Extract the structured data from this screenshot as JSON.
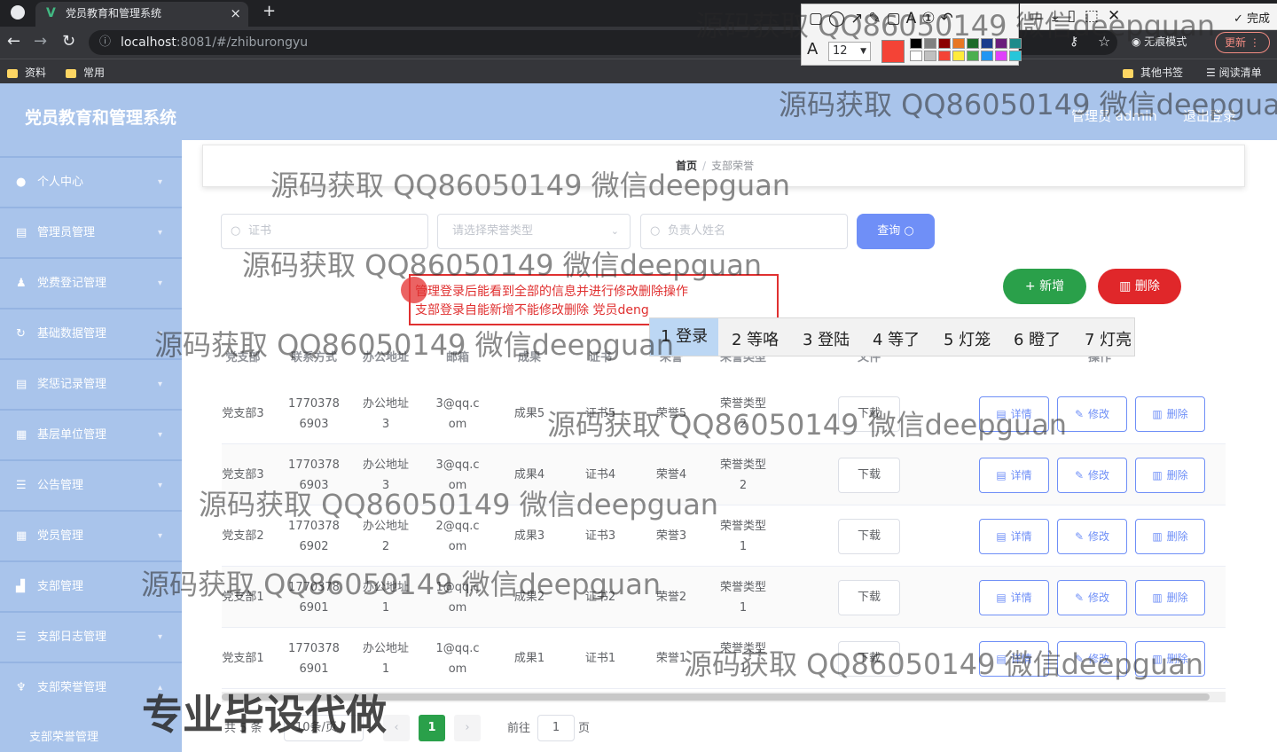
{
  "browser": {
    "tab_title": "党员教育和管理系统",
    "tab_favicon": "V",
    "url_host": "localhost",
    "url_rest": ":8081/#/zhiburongyu",
    "incognito_label": "无痕模式",
    "update_label": "更新",
    "bookmarks": [
      "资料",
      "常用"
    ],
    "bookmarks_right": [
      "其他书签",
      "阅读清单"
    ]
  },
  "annotation_tool": {
    "font_size": "12",
    "current_color": "#f44336",
    "done_label": "完成"
  },
  "app": {
    "title": "党员教育和管理系统",
    "admin_label": "管理员 admin",
    "logout_label": "退出登录"
  },
  "sidebar": {
    "items": [
      {
        "label": "个人中心",
        "icon": "user-icon"
      },
      {
        "label": "管理员管理",
        "icon": "list-icon"
      },
      {
        "label": "党费登记管理",
        "icon": "person-icon"
      },
      {
        "label": "基础数据管理",
        "icon": "refresh-icon"
      },
      {
        "label": "奖惩记录管理",
        "icon": "list-icon"
      },
      {
        "label": "基层单位管理",
        "icon": "grid-icon"
      },
      {
        "label": "公告管理",
        "icon": "menu-icon"
      },
      {
        "label": "党员管理",
        "icon": "grid-icon"
      },
      {
        "label": "支部管理",
        "icon": "chart-icon"
      },
      {
        "label": "支部日志管理",
        "icon": "menu-icon"
      },
      {
        "label": "支部荣誉管理",
        "icon": "trophy-icon"
      }
    ],
    "sub_item": "支部荣誉管理"
  },
  "breadcrumb": {
    "home": "首页",
    "separator": "/",
    "current": "支部荣誉"
  },
  "search": {
    "certificate_placeholder": "证书",
    "honor_type_placeholder": "请选择荣誉类型",
    "leader_placeholder": "负责人姓名",
    "query_label": "查询"
  },
  "actions": {
    "add_label": "新增",
    "delete_label": "删除"
  },
  "note": {
    "line1": "管理登录后能看到全部的信息并进行修改删除操作",
    "line2": "支部登录自能新增不能修改删除 党员deng"
  },
  "ime": {
    "candidates": [
      "1 登录",
      "2 等咯",
      "3 登陆",
      "4 等了",
      "5 灯笼",
      "6 瞪了",
      "7 灯亮"
    ]
  },
  "table": {
    "headers": [
      "党支部",
      "联系方式",
      "办公地址",
      "邮箱",
      "成果",
      "证书",
      "荣誉",
      "荣誉类型",
      "文件",
      "操作"
    ],
    "rows": [
      {
        "branch": "党支部3",
        "phone1": "1770378",
        "phone2": "6903",
        "addr1": "办公地址",
        "addr2": "3",
        "email1": "3@qq.c",
        "email2": "om",
        "result": "成果5",
        "cert": "证书5",
        "honor": "荣誉5",
        "type1": "荣誉类型",
        "type2": "2"
      },
      {
        "branch": "党支部3",
        "phone1": "1770378",
        "phone2": "6903",
        "addr1": "办公地址",
        "addr2": "3",
        "email1": "3@qq.c",
        "email2": "om",
        "result": "成果4",
        "cert": "证书4",
        "honor": "荣誉4",
        "type1": "荣誉类型",
        "type2": "2"
      },
      {
        "branch": "党支部2",
        "phone1": "1770378",
        "phone2": "6902",
        "addr1": "办公地址",
        "addr2": "2",
        "email1": "2@qq.c",
        "email2": "om",
        "result": "成果3",
        "cert": "证书3",
        "honor": "荣誉3",
        "type1": "荣誉类型",
        "type2": "1"
      },
      {
        "branch": "党支部1",
        "phone1": "1770378",
        "phone2": "6901",
        "addr1": "办公地址",
        "addr2": "1",
        "email1": "1@qq.c",
        "email2": "om",
        "result": "成果2",
        "cert": "证书2",
        "honor": "荣誉2",
        "type1": "荣誉类型",
        "type2": "1"
      },
      {
        "branch": "党支部1",
        "phone1": "1770378",
        "phone2": "6901",
        "addr1": "办公地址",
        "addr2": "1",
        "email1": "1@qq.c",
        "email2": "om",
        "result": "成果1",
        "cert": "证书1",
        "honor": "荣誉1",
        "type1": "荣誉类型",
        "type2": "1"
      }
    ],
    "download_label": "下载",
    "detail_label": "详情",
    "edit_label": "修改",
    "delete_label": "删除"
  },
  "pagination": {
    "total_label": "共 5 条",
    "page_size": "10条/页",
    "current_page": "1",
    "goto_label": "前往",
    "goto_value": "1",
    "page_unit": "页"
  },
  "watermarks": {
    "text": "源码获取 QQ86050149 微信deepguan",
    "big_text": "专业毕设代做"
  },
  "colors": {
    "header": "#a9c4eb",
    "primary": "#6f8ff7",
    "success": "#2aa04a",
    "danger": "#e0272a"
  }
}
